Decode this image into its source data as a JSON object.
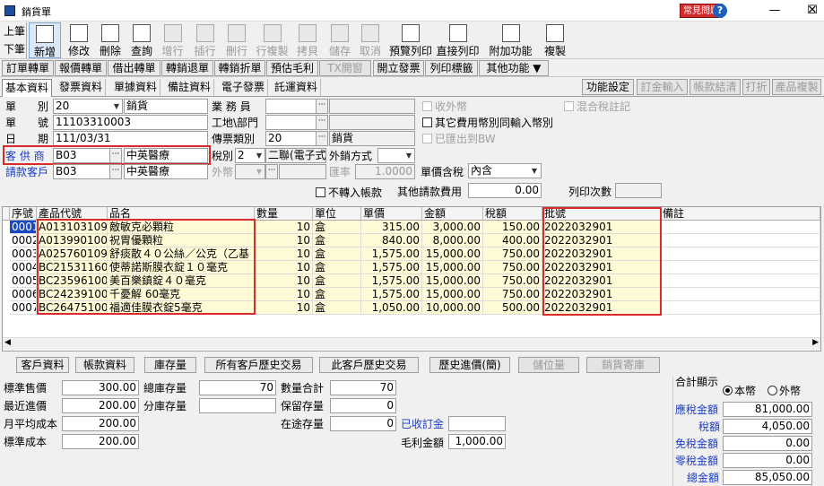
{
  "window": {
    "title": "銷貨單",
    "badge": "常見問題",
    "help": "?",
    "min": "—",
    "max": "☐",
    "close": "✕"
  },
  "nav": {
    "prev": "上筆",
    "next": "下筆"
  },
  "toolbar": [
    {
      "label": "新增",
      "icon": "new-doc-icon",
      "enabled": true,
      "selected": true
    },
    {
      "label": "修改",
      "icon": "edit-icon",
      "enabled": true
    },
    {
      "label": "刪除",
      "icon": "delete-icon",
      "enabled": true
    },
    {
      "label": "查詢",
      "icon": "query-icon",
      "enabled": true
    },
    {
      "label": "增行",
      "icon": "add-row-icon",
      "enabled": false
    },
    {
      "label": "插行",
      "icon": "insert-row-icon",
      "enabled": false
    },
    {
      "label": "刪行",
      "icon": "delete-row-icon",
      "enabled": false
    },
    {
      "label": "行複製",
      "icon": "copy-row-icon",
      "enabled": false
    },
    {
      "label": "拷貝",
      "icon": "copy-icon",
      "enabled": false
    },
    {
      "label": "儲存",
      "icon": "save-icon",
      "enabled": false
    },
    {
      "label": "取消",
      "icon": "cancel-icon",
      "enabled": false
    },
    {
      "label": "預覽列印",
      "icon": "print-preview-icon",
      "enabled": true
    },
    {
      "label": "直接列印",
      "icon": "print-icon",
      "enabled": true
    },
    {
      "label": "附加功能",
      "icon": "extra-functions-icon",
      "enabled": true
    },
    {
      "label": "複製",
      "icon": "duplicate-icon",
      "enabled": true
    }
  ],
  "actions": [
    {
      "label": "訂單轉單",
      "enabled": true
    },
    {
      "label": "報價轉單",
      "enabled": true
    },
    {
      "label": "借出轉單",
      "enabled": true
    },
    {
      "label": "轉銷退單",
      "enabled": true
    },
    {
      "label": "轉銷折單",
      "enabled": true
    },
    {
      "label": "預估毛利",
      "enabled": true
    },
    {
      "label": "TX開窗",
      "enabled": false
    },
    {
      "label": "開立發票",
      "enabled": true
    },
    {
      "label": "列印標籤",
      "enabled": true
    },
    {
      "label": "其他功能 ▼",
      "enabled": true
    }
  ],
  "tabs": [
    "基本資料",
    "發票資料",
    "單據資料",
    "備註資料",
    "電子發票",
    "託運資料"
  ],
  "right_buttons": [
    {
      "label": "功能設定",
      "enabled": true
    },
    {
      "label": "訂金輸入",
      "enabled": false
    },
    {
      "label": "帳款結清",
      "enabled": false
    },
    {
      "label": "打折",
      "enabled": false
    },
    {
      "label": "產品複製",
      "enabled": false
    }
  ],
  "header": {
    "type_label": "單　　別",
    "type_code": "20",
    "type_name": "銷貨",
    "no_label": "單　　號",
    "no": "11103310003",
    "date_label": "日　　期",
    "date": "111/03/31",
    "customer_label": "客 供 商",
    "customer_code": "B03",
    "customer_name": "中英醫療",
    "bill_label": "請款客戶",
    "bill_code": "B03",
    "bill_name": "中英醫療",
    "sales_label": "業 務 員",
    "dept_label": "工地\\部門",
    "vtype_label": "傳票類別",
    "vtype_code": "20",
    "vtype_name": "銷貨",
    "tax_label": "稅別",
    "tax_code": "2",
    "tax_name": "二聯(電子式",
    "export_label": "外銷方式",
    "fx_label": "外幣",
    "rate_label": "匯率",
    "rate": "1.0000",
    "price_tax_label": "單價含稅",
    "price_tax": "內含",
    "other_fee_label": "其他請款費用",
    "other_fee": "0.00",
    "print_count_label": "列印次數",
    "print_count": "",
    "chk_foreign": "收外幣",
    "chk_other_currency": "其它費用幣別同輸入幣別",
    "chk_bw": "已匯出到BW",
    "chk_mixed": "混合稅註記",
    "chk_no_ar": "不轉入帳款"
  },
  "table": {
    "columns": [
      "序號",
      "產品代號",
      "品名",
      "數量",
      "單位",
      "單價",
      "金額",
      "稅額",
      "批號",
      "備註"
    ],
    "rows": [
      [
        "0001",
        "A013103109",
        "敵敏克必顆粒",
        "10",
        "盒",
        "315.00",
        "3,000.00",
        "150.00",
        "2022032901",
        ""
      ],
      [
        "0002",
        "A013990100",
        "祝胃優顆粒",
        "10",
        "盒",
        "840.00",
        "8,000.00",
        "400.00",
        "2022032901",
        ""
      ],
      [
        "0003",
        "A025760109",
        "舒痰散４０公絲／公克（乙基",
        "10",
        "盒",
        "1,575.00",
        "15,000.00",
        "750.00",
        "2022032901",
        ""
      ],
      [
        "0004",
        "BC21531160",
        "使蒂諾斯膜衣錠１０毫克",
        "10",
        "盒",
        "1,575.00",
        "15,000.00",
        "750.00",
        "2022032901",
        ""
      ],
      [
        "0005",
        "BC23596100",
        "美百樂鎮錠４０毫克",
        "10",
        "盒",
        "1,575.00",
        "15,000.00",
        "750.00",
        "2022032901",
        ""
      ],
      [
        "0006",
        "BC24239100",
        "千憂解 60毫克",
        "10",
        "盒",
        "1,575.00",
        "15,000.00",
        "750.00",
        "2022032901",
        ""
      ],
      [
        "0007",
        "BC26475100",
        "福適佳膜衣錠5毫克",
        "10",
        "盒",
        "1,050.00",
        "10,000.00",
        "500.00",
        "2022032901",
        ""
      ]
    ]
  },
  "lower_buttons": [
    {
      "label": "客戶資料",
      "enabled": true
    },
    {
      "label": "帳款資料",
      "enabled": true
    },
    {
      "label": "庫存量",
      "enabled": true
    },
    {
      "label": "所有客戶歷史交易",
      "enabled": true
    },
    {
      "label": "此客戶歷史交易",
      "enabled": true
    },
    {
      "label": "歷史進價(簡)",
      "enabled": true
    },
    {
      "label": "儲位量",
      "enabled": false
    },
    {
      "label": "銷貨寄庫",
      "enabled": false
    }
  ],
  "stats": {
    "std_price_label": "標準售價",
    "std_price": "300.00",
    "last_price_label": "最近進價",
    "last_price": "200.00",
    "avg_cost_label": "月平均成本",
    "avg_cost": "200.00",
    "std_cost_label": "標準成本",
    "std_cost": "200.00",
    "total_stock_label": "總庫存量",
    "total_stock": "70",
    "branch_stock_label": "分庫存量",
    "branch_stock": "",
    "qty_total_label": "數量合計",
    "qty_total": "70",
    "reserved_label": "保留存量",
    "reserved": "0",
    "transit_label": "在途存量",
    "transit": "0",
    "received_label": "已收訂金",
    "received": "",
    "gross_label": "毛利金額",
    "gross": "1,000.00"
  },
  "totals": {
    "title": "合計顯示",
    "opt_local": "本幣",
    "opt_foreign": "外幣",
    "taxable_label": "應稅金額",
    "taxable": "81,000.00",
    "tax_label": "稅額",
    "tax": "4,050.00",
    "exempt_label": "免稅金額",
    "exempt": "0.00",
    "zero_label": "零稅金額",
    "zero": "0.00",
    "total_label": "總金額",
    "total": "85,050.00"
  },
  "colors": {
    "blue_label": "#1c3cc9",
    "highlight": "#d92b2b",
    "row_bg": "#fffbd6",
    "selection": "#1b49c4"
  }
}
